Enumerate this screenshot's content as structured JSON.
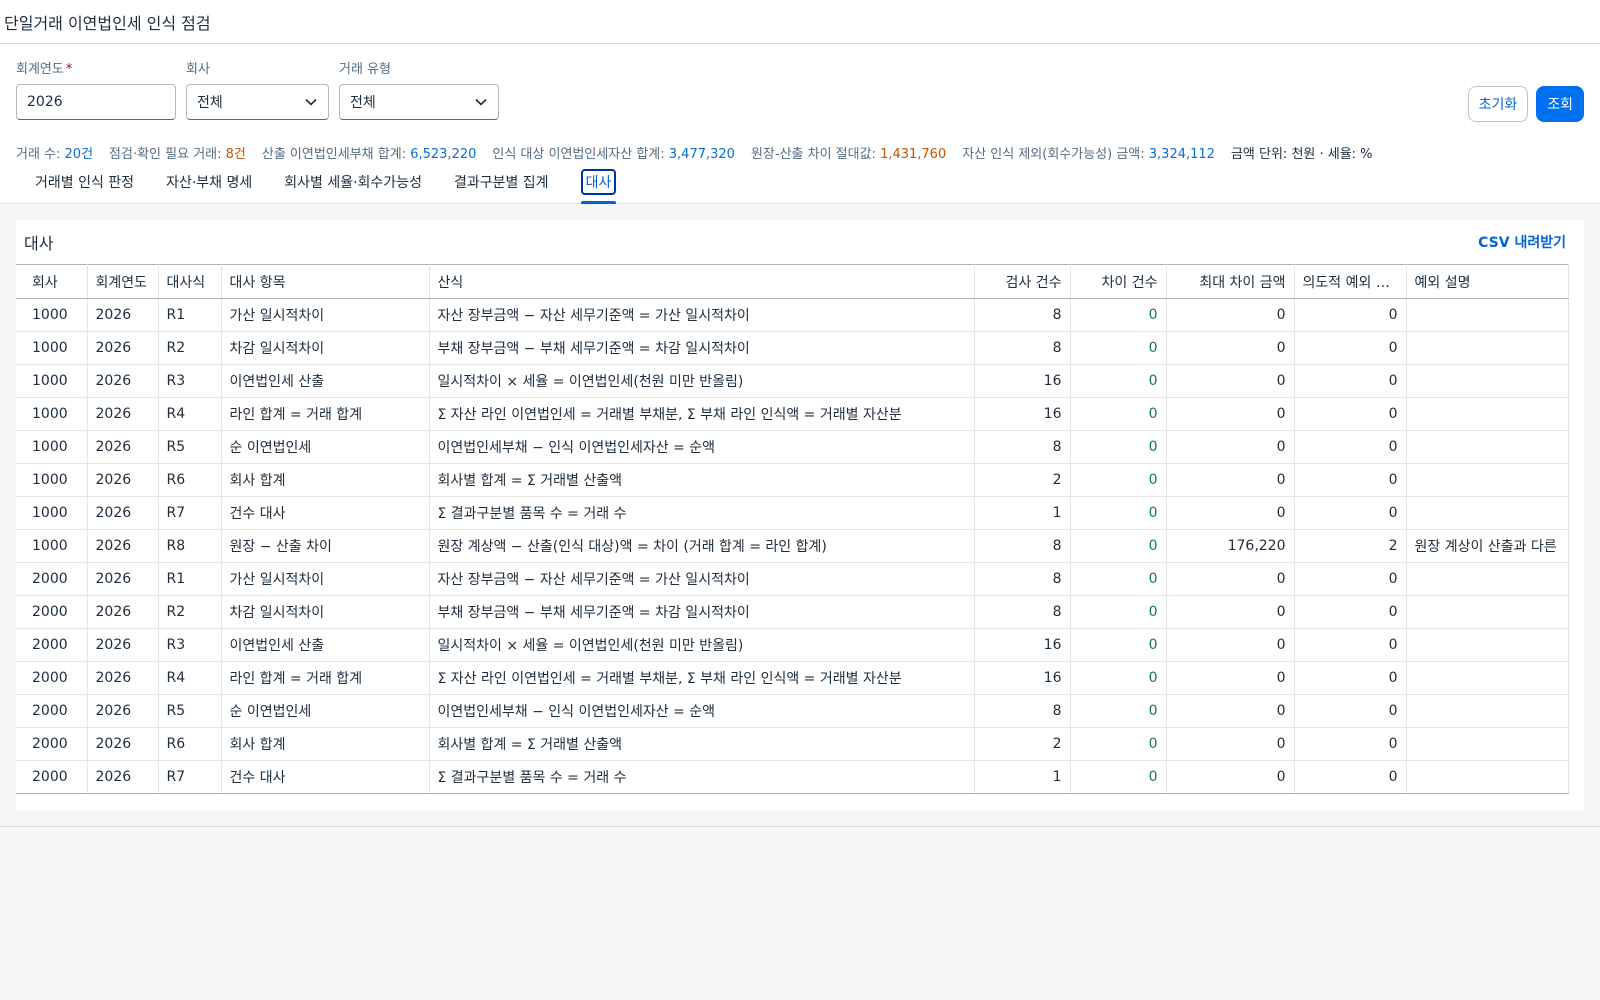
{
  "header": {
    "title": "단일거래 이연법인세 인식 점검"
  },
  "filters": {
    "fiscal_year": {
      "label": "회계연도",
      "required_mark": "*",
      "value": "2026"
    },
    "company": {
      "label": "회사",
      "value": "전체"
    },
    "txn_type": {
      "label": "거래 유형",
      "value": "전체"
    }
  },
  "actions": {
    "reset_label": "초기화",
    "search_label": "조회"
  },
  "kpis": {
    "txn_count_label": "거래 수: ",
    "txn_count_value": "20건",
    "check_label": "점검·확인 필요 거래: ",
    "check_value": "8건",
    "dtl_label": "산출 이연법인세부채 합계: ",
    "dtl_value": "6,523,220",
    "dta_label": "인식 대상 이연법인세자산 합계: ",
    "dta_value": "3,477,320",
    "diff_label": "원장-산출 차이 절대값: ",
    "diff_value": "1,431,760",
    "excl_label": "자산 인식 제외(회수가능성) 금액: ",
    "excl_value": "3,324,112",
    "unit": "금액 단위: 천원 · 세율: %"
  },
  "tabs": [
    {
      "label": "거래별 인식 판정"
    },
    {
      "label": "자산·부채 명세"
    },
    {
      "label": "회사별 세율·회수가능성"
    },
    {
      "label": "결과구분별 집계"
    },
    {
      "label": "대사"
    }
  ],
  "panel": {
    "title": "대사",
    "csv_label": "CSV 내려받기"
  },
  "table": {
    "columns": [
      "회사",
      "회계연도",
      "대사식",
      "대사 항목",
      "산식",
      "검사 건수",
      "차이 건수",
      "최대 차이 금액",
      "의도적 예외 건수",
      "예외 설명"
    ],
    "rows": [
      [
        "1000",
        "2026",
        "R1",
        "가산 일시적차이",
        "자산 장부금액 − 자산 세무기준액 = 가산 일시적차이",
        "8",
        "0",
        "0",
        "0",
        ""
      ],
      [
        "1000",
        "2026",
        "R2",
        "차감 일시적차이",
        "부채 장부금액 − 부채 세무기준액 = 차감 일시적차이",
        "8",
        "0",
        "0",
        "0",
        ""
      ],
      [
        "1000",
        "2026",
        "R3",
        "이연법인세 산출",
        "일시적차이 × 세율 = 이연법인세(천원 미만 반올림)",
        "16",
        "0",
        "0",
        "0",
        ""
      ],
      [
        "1000",
        "2026",
        "R4",
        "라인 합계 = 거래 합계",
        "Σ 자산 라인 이연법인세 = 거래별 부채분, Σ 부채 라인 인식액 = 거래별 자산분",
        "16",
        "0",
        "0",
        "0",
        ""
      ],
      [
        "1000",
        "2026",
        "R5",
        "순 이연법인세",
        "이연법인세부채 − 인식 이연법인세자산 = 순액",
        "8",
        "0",
        "0",
        "0",
        ""
      ],
      [
        "1000",
        "2026",
        "R6",
        "회사 합계",
        "회사별 합계 = Σ 거래별 산출액",
        "2",
        "0",
        "0",
        "0",
        ""
      ],
      [
        "1000",
        "2026",
        "R7",
        "건수 대사",
        "Σ 결과구분별 품목 수 = 거래 수",
        "1",
        "0",
        "0",
        "0",
        ""
      ],
      [
        "1000",
        "2026",
        "R8",
        "원장 − 산출 차이",
        "원장 계상액 − 산출(인식 대상)액 = 차이 (거래 합계 = 라인 합계)",
        "8",
        "0",
        "176,220",
        "2",
        "원장 계상이 산출과 다른"
      ],
      [
        "2000",
        "2026",
        "R1",
        "가산 일시적차이",
        "자산 장부금액 − 자산 세무기준액 = 가산 일시적차이",
        "8",
        "0",
        "0",
        "0",
        ""
      ],
      [
        "2000",
        "2026",
        "R2",
        "차감 일시적차이",
        "부채 장부금액 − 부채 세무기준액 = 차감 일시적차이",
        "8",
        "0",
        "0",
        "0",
        ""
      ],
      [
        "2000",
        "2026",
        "R3",
        "이연법인세 산출",
        "일시적차이 × 세율 = 이연법인세(천원 미만 반올림)",
        "16",
        "0",
        "0",
        "0",
        ""
      ],
      [
        "2000",
        "2026",
        "R4",
        "라인 합계 = 거래 합계",
        "Σ 자산 라인 이연법인세 = 거래별 부채분, Σ 부채 라인 인식액 = 거래별 자산분",
        "16",
        "0",
        "0",
        "0",
        ""
      ],
      [
        "2000",
        "2026",
        "R5",
        "순 이연법인세",
        "이연법인세부채 − 인식 이연법인세자산 = 순액",
        "8",
        "0",
        "0",
        "0",
        ""
      ],
      [
        "2000",
        "2026",
        "R6",
        "회사 합계",
        "회사별 합계 = Σ 거래별 산출액",
        "2",
        "0",
        "0",
        "0",
        ""
      ],
      [
        "2000",
        "2026",
        "R7",
        "건수 대사",
        "Σ 결과구분별 품목 수 = 거래 수",
        "1",
        "0",
        "0",
        "0",
        ""
      ]
    ]
  },
  "colors": {
    "accent": "#0070f2",
    "link": "#0064d9",
    "positive": "#107e3e",
    "warning": "#c35500"
  }
}
